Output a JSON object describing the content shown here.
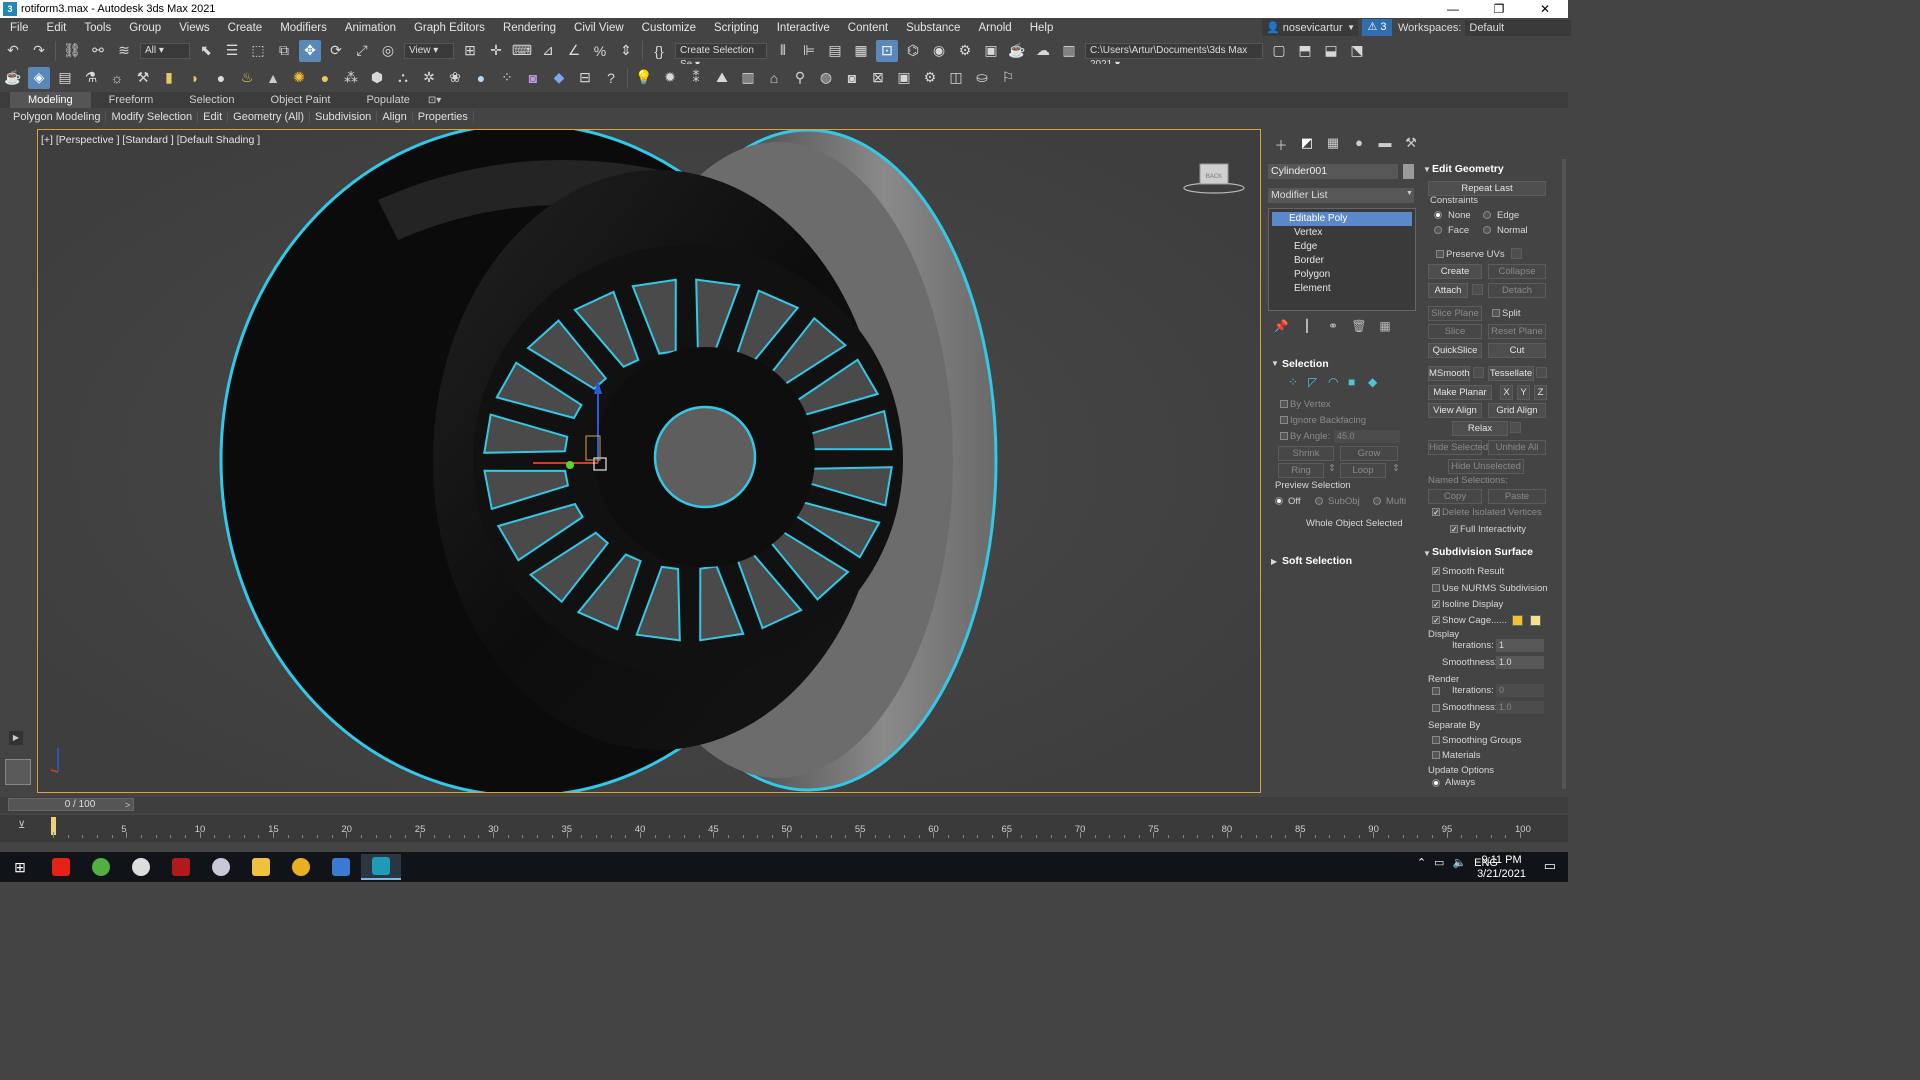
{
  "window": {
    "title": "rotiform3.max - Autodesk 3ds Max 2021",
    "controls": [
      "—",
      "❐",
      "✕"
    ]
  },
  "menu": {
    "items": [
      "File",
      "Edit",
      "Tools",
      "Group",
      "Views",
      "Create",
      "Modifiers",
      "Animation",
      "Graph Editors",
      "Rendering",
      "Civil View",
      "Customize",
      "Scripting",
      "Interactive",
      "Content",
      "Substance",
      "Arnold",
      "Help"
    ],
    "user": "nosevicartur",
    "notifications": "3",
    "workspaces_label": "Workspaces:",
    "workspace_value": "Default"
  },
  "toolbar": {
    "filter_value": "All",
    "ref_coord_value": "View",
    "selection_set": "Create Selection Se",
    "project_path": "C:\\Users\\Artur\\Documents\\3ds Max 2021"
  },
  "ribbon": {
    "tabs": [
      "Modeling",
      "Freeform",
      "Selection",
      "Object Paint",
      "Populate"
    ],
    "panel_items": [
      "Polygon Modeling",
      "Modify Selection",
      "Edit",
      "Geometry (All)",
      "Subdivision",
      "Align",
      "Properties"
    ]
  },
  "viewport": {
    "label": "[+] [Perspective ] [Standard ] [Default Shading ]",
    "viewcube_label": "BACK",
    "spoke_count": 20,
    "selection_color": "#32c8e8",
    "frame_color": "#d8a33a"
  },
  "command_panel": {
    "object_name": "Cylinder001",
    "modifier_list": "Modifier List",
    "stack": {
      "top": "Editable Poly",
      "subs": [
        "Vertex",
        "Edge",
        "Border",
        "Polygon",
        "Element"
      ]
    }
  },
  "selection_rollout": {
    "title": "Selection",
    "by_vertex": "By Vertex",
    "ignore_backfacing": "Ignore Backfacing",
    "by_angle": "By Angle:",
    "angle_value": "45.0",
    "shrink": "Shrink",
    "grow": "Grow",
    "ring": "Ring",
    "loop": "Loop",
    "preview_selection": "Preview Selection",
    "off": "Off",
    "subobj": "SubObj",
    "multi": "Multi",
    "status": "Whole Object Selected"
  },
  "soft_selection": {
    "title": "Soft Selection"
  },
  "edit_geometry": {
    "title": "Edit Geometry",
    "repeat_last": "Repeat Last",
    "constraints": "Constraints",
    "none": "None",
    "edge": "Edge",
    "face": "Face",
    "normal": "Normal",
    "preserve_uvs": "Preserve UVs",
    "create": "Create",
    "collapse": "Collapse",
    "attach": "Attach",
    "detach": "Detach",
    "slice_plane": "Slice Plane",
    "split": "Split",
    "slice": "Slice",
    "reset_plane": "Reset Plane",
    "quickslice": "QuickSlice",
    "cut": "Cut",
    "msmooth": "MSmooth",
    "tessellate": "Tessellate",
    "make_planar": "Make Planar",
    "x": "X",
    "y": "Y",
    "z": "Z",
    "view_align": "View Align",
    "grid_align": "Grid Align",
    "relax": "Relax",
    "hide_selected": "Hide Selected",
    "unhide_all": "Unhide All",
    "hide_unselected": "Hide Unselected",
    "named_selections": "Named Selections:",
    "copy": "Copy",
    "paste": "Paste",
    "delete_isolated": "Delete Isolated Vertices",
    "full_interactivity": "Full Interactivity"
  },
  "subdivision": {
    "title": "Subdivision Surface",
    "smooth_result": "Smooth Result",
    "use_nurms": "Use NURMS Subdivision",
    "isoline": "Isoline Display",
    "show_cage": "Show Cage......",
    "display": "Display",
    "iterations": "Iterations:",
    "disp_iter": "1",
    "smoothness": "Smoothness:",
    "disp_smooth": "1.0",
    "render": "Render",
    "rend_iter": "0",
    "rend_smooth": "1.0",
    "separate_by": "Separate By",
    "smoothing_groups": "Smoothing Groups",
    "materials": "Materials",
    "update_options": "Update Options",
    "always": "Always",
    "cage_color_1": "#f2c12e",
    "cage_color_2": "#f5e28a"
  },
  "timeline": {
    "frame_display": "0 / 100",
    "ticks": [
      "0",
      "5",
      "10",
      "15",
      "20",
      "25",
      "30",
      "35",
      "40",
      "45",
      "50",
      "55",
      "60",
      "65",
      "70",
      "75",
      "80",
      "85",
      "90",
      "95",
      "100"
    ]
  },
  "taskbar": {
    "time": "9:11 PM",
    "date": "3/21/2021",
    "lang": "ENG"
  }
}
